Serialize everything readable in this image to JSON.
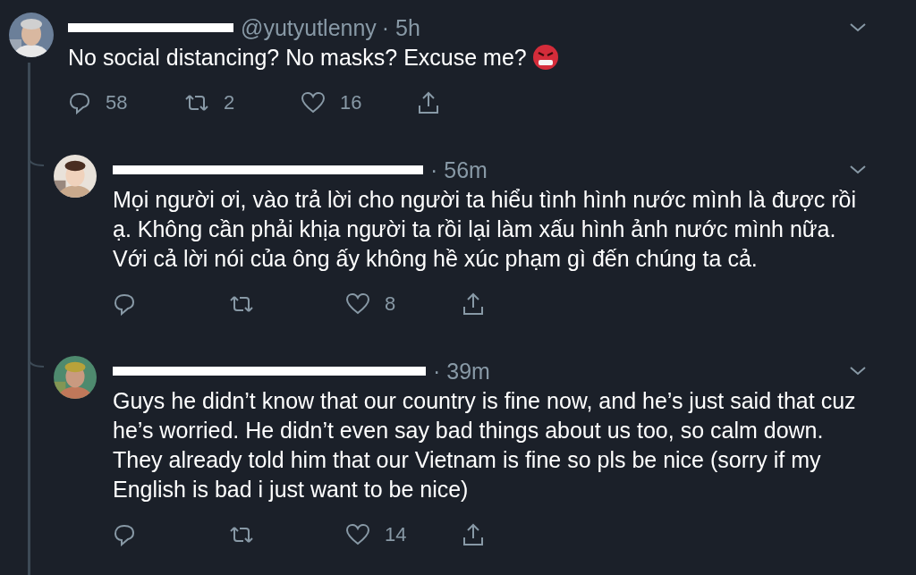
{
  "tweets": [
    {
      "kind": "original",
      "redacted": true,
      "handle": "@yutyutlenny",
      "time": "· 5h",
      "text": "No social distancing? No masks? Excuse me?",
      "has_emoji": true,
      "replies": "58",
      "retweets": "2",
      "likes": "16"
    },
    {
      "kind": "reply",
      "redacted": true,
      "time": "· 56m",
      "text": "Mọi người ơi, vào trả lời cho người ta hiểu tình hình nước mình là được rồi ạ. Không cần phải khịa người ta rồi lại làm xấu hình ảnh nước mình nữa. Với cả lời nói của ông ấy không hề xúc phạm gì đến chúng ta cả.",
      "has_emoji": false,
      "likes": "8"
    },
    {
      "kind": "reply",
      "redacted": true,
      "time": "· 39m",
      "text": "Guys he didn’t know that our country is fine now, and he’s just said that cuz he’s worried. He didn’t even say bad things about us too, so calm down. They already told him that our Vietnam is fine so pls be nice (sorry if my English is bad i just want to be nice)",
      "has_emoji": false,
      "likes": "14"
    }
  ]
}
